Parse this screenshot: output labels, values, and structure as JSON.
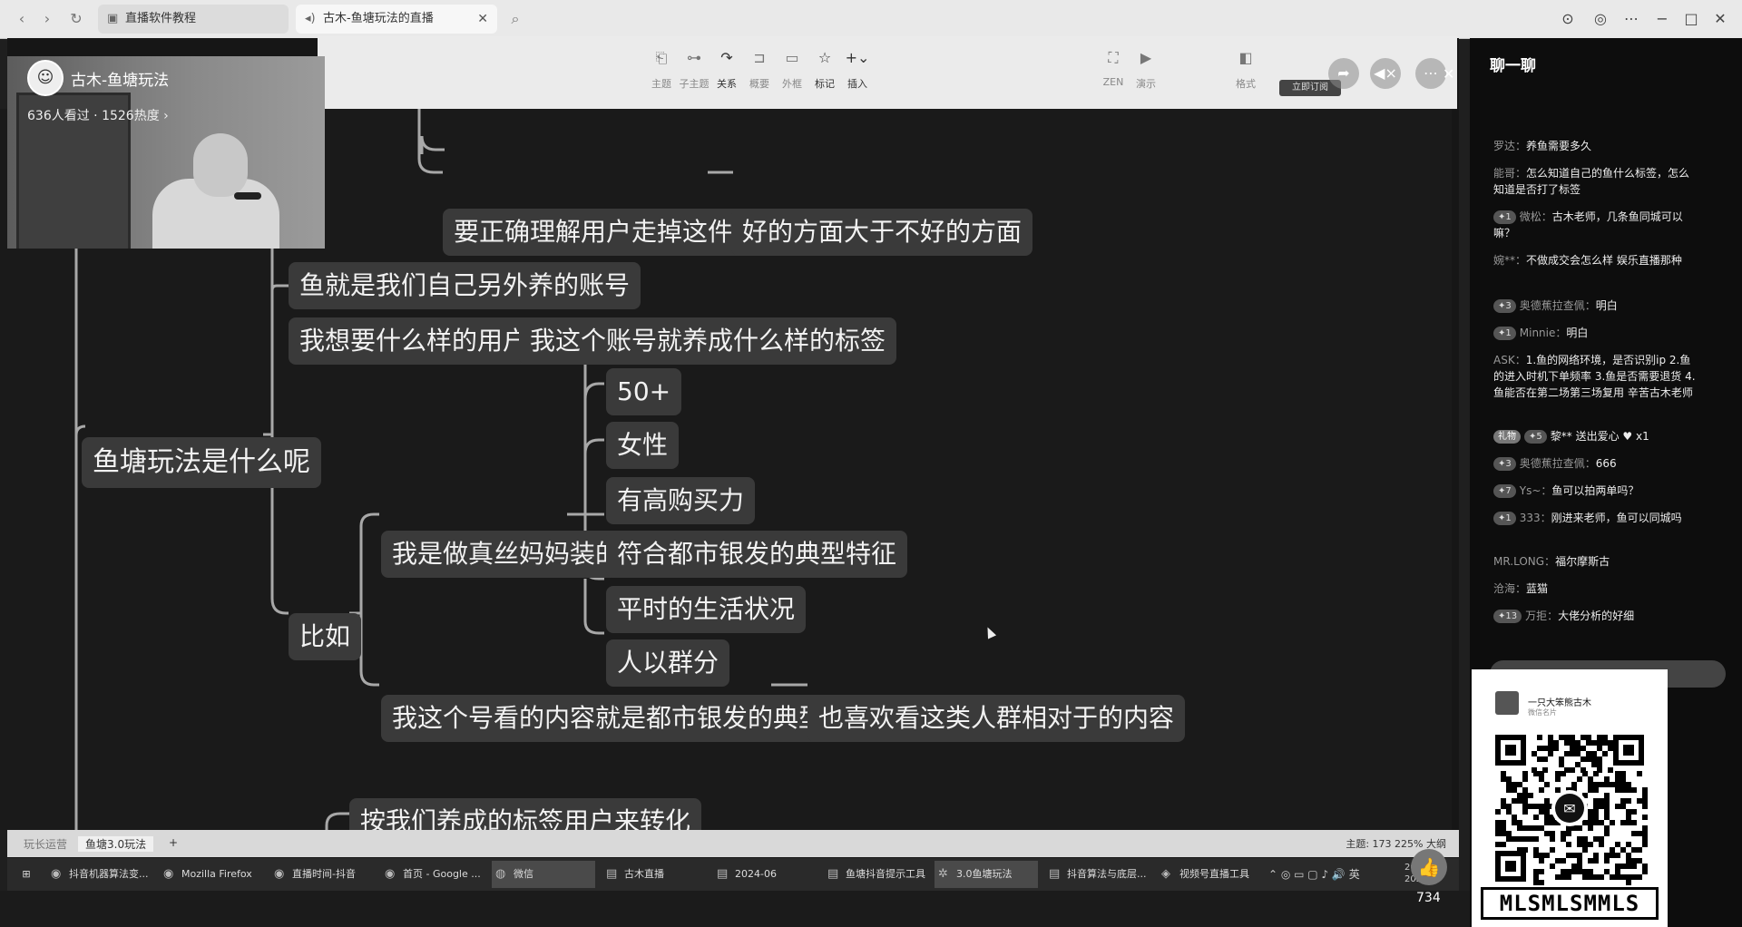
{
  "browser": {
    "tabs": [
      {
        "label": "直播软件教程",
        "icon": "doc-icon"
      },
      {
        "label": "古木-鱼塘玩法的直播",
        "icon": "speaker-icon"
      }
    ]
  },
  "toolbar": {
    "items": [
      "主题",
      "子主题",
      "关系",
      "概要",
      "外框",
      "标记",
      "插入",
      "ZEN",
      "演示",
      "格式"
    ],
    "cta": "立即订阅"
  },
  "stream": {
    "streamer_name": "古木-鱼塘玩法",
    "viewer_info": "636人看过 · 1526热度 ›"
  },
  "mindmap": {
    "nodes": {
      "root": "鱼塘玩法是什么呢",
      "top_a": "要正确理解用户走掉这件事",
      "top_b": "好的方面大于不好的方面",
      "n1": "鱼就是我们自己另外养的账号",
      "n2": "我想要什么样的用户",
      "n2b": "我这个账号就养成什么样的标签",
      "attr1": "50+",
      "attr2": "女性",
      "attr3": "有高购买力",
      "attr4": "符合都市银发的典型特征",
      "attr5": "平时的生活状况",
      "attr6": "人以群分",
      "example": "比如",
      "ex1": "我是做真丝妈妈装的",
      "ex2": "我这个号看的内容就是都市银发的典型特征",
      "ex2b": "也喜欢看这类人群相对于的内容",
      "bottom": "按我们养成的标签用户来转化"
    }
  },
  "sheet_bar": {
    "tab1": "玩长运营",
    "tab2": "鱼塘3.0玩法",
    "add": "+",
    "right": "主题: 173    225%    大纲"
  },
  "taskbar": {
    "items": [
      "抖音机器算法变...",
      "Mozilla Firefox",
      "直播时间-抖音电...",
      "首页 - Google ...",
      "微信",
      "古木直播",
      "2024-06",
      "鱼塘抖音提示工具",
      "3.0鱼塘玩法",
      "抖音算法与底层...",
      "视频号直播工具"
    ],
    "clock_time": "20:33",
    "clock_date": "2024/6/"
  },
  "likes": {
    "count": "734"
  },
  "chat": {
    "title": "聊一聊",
    "messages": [
      {
        "user": "罗达：",
        "text": "养鱼需要多久",
        "badge": ""
      },
      {
        "user": "能哥：",
        "text": "怎么知道自己的鱼什么标签，怎么知道是否打了标签",
        "badge": ""
      },
      {
        "user": "微松：",
        "text": "古木老师，几条鱼同城可以嘛？",
        "badge": "1"
      },
      {
        "user": "婉**：",
        "text": "不做成交会怎么样 娱乐直播那种",
        "badge": ""
      },
      {
        "user": "奥德蕉拉查佩：",
        "text": "明白",
        "badge": "3"
      },
      {
        "user": "Minnie：",
        "text": "明白",
        "badge": "1"
      },
      {
        "user": "ASK：",
        "text": "1.鱼的网络环境，是否识别ip 2.鱼的进入时机下单频率 3.鱼是否需要退货 4.鱼能否在第二场第三场复用 辛苦古木老师",
        "badge": ""
      },
      {
        "user": "黎** 送出爱心",
        "text": "x1",
        "badge": "5",
        "gift": "礼物"
      },
      {
        "user": "奥德蕉拉查佩：",
        "text": "666",
        "badge": "3"
      },
      {
        "user": "Ys~：",
        "text": "鱼可以拍两单吗？",
        "badge": "7"
      },
      {
        "user": "333：",
        "text": "刚进来老师，鱼可以同城吗",
        "badge": "1"
      },
      {
        "user": "MR.LONG：",
        "text": "福尔摩斯古",
        "badge": ""
      },
      {
        "user": "沧海：",
        "text": "蓝猫",
        "badge": ""
      },
      {
        "user": "万拒：",
        "text": "大佬分析的好细",
        "badge": "13"
      }
    ]
  },
  "qr_card": {
    "name": "一只大笨熊古木",
    "sub": "微信名片",
    "watermark": "MLSMLSMMLS"
  }
}
